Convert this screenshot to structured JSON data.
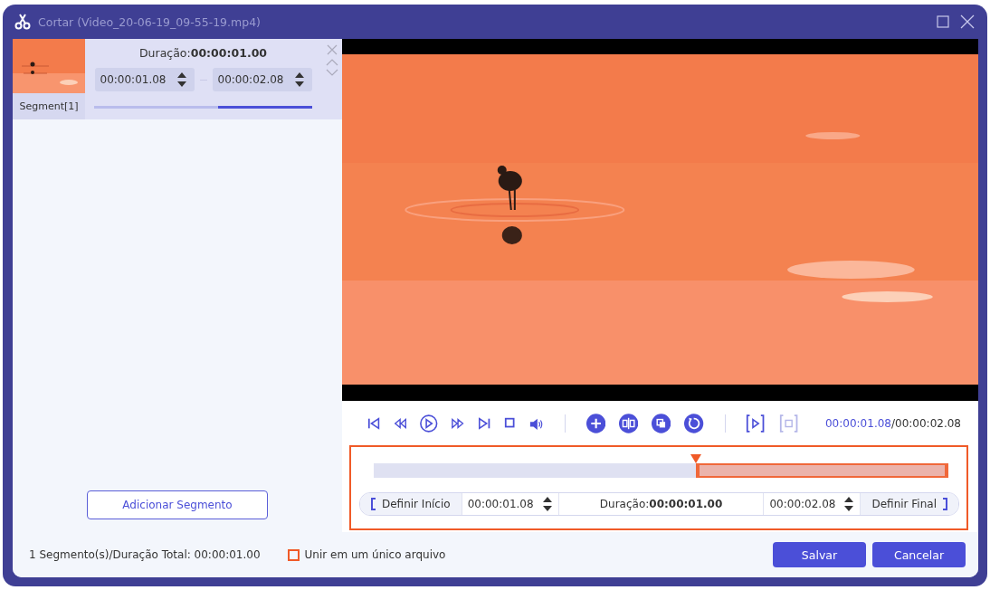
{
  "window": {
    "title": "Cortar (Video_20-06-19_09-55-19.mp4)"
  },
  "segments": [
    {
      "label": "Segment[1]",
      "duration_label": "Duração:",
      "duration": "00:00:01.00",
      "start": "00:00:01.08",
      "end": "00:00:02.08",
      "level": 0.43,
      "selected": true
    }
  ],
  "add_segment_button": "Adicionar Segmento",
  "player": {
    "time_current": "00:00:01.08",
    "time_total": "/00:00:02.08"
  },
  "trim": {
    "set_start": "Definir Início",
    "start": "00:00:01.08",
    "duration_label": "Duração:",
    "duration": "00:00:01.00",
    "end": "00:00:02.08",
    "set_end": "Definir Final"
  },
  "status": "1 Segmento(s)/Duração Total: 00:00:01.00",
  "merge": {
    "label": "Unir em um único arquivo",
    "checked": false
  },
  "buttons": [
    "Salvar",
    "Cancelar"
  ]
}
